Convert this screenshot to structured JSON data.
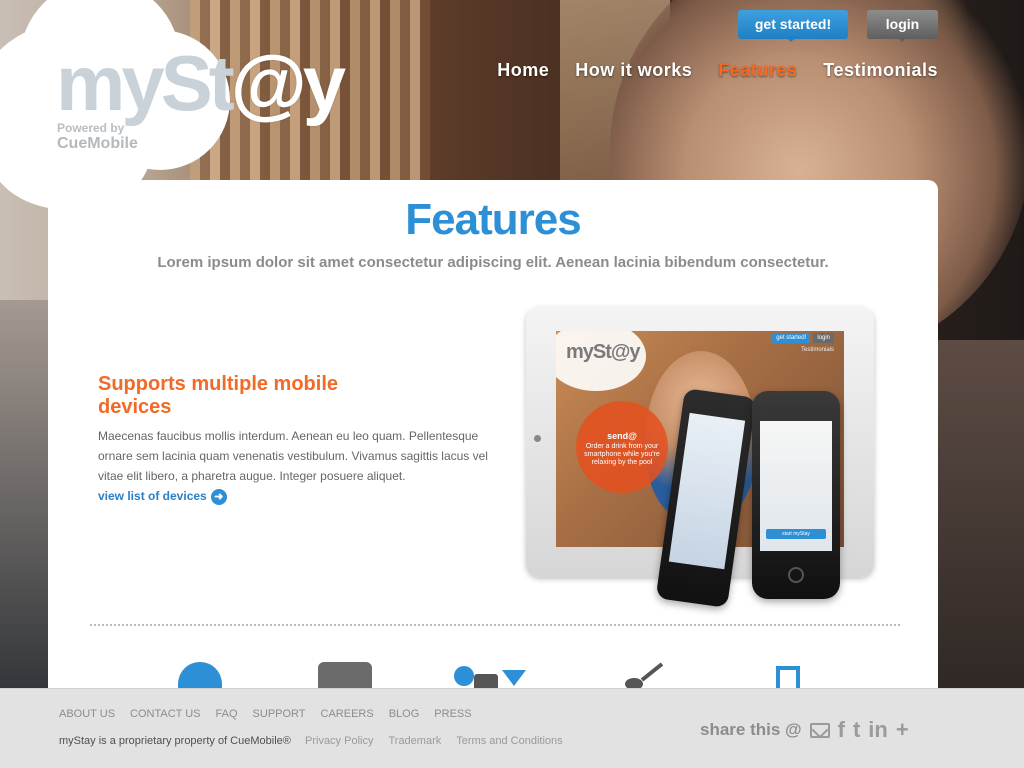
{
  "brand": {
    "logo_text": "myst@y",
    "logo_main": "my",
    "logo_st": "St",
    "logo_at": "@y",
    "powered_by": "Powered by",
    "company": "CueMobile"
  },
  "top_buttons": {
    "get_started": "get started!",
    "login": "login"
  },
  "nav": {
    "items": [
      "Home",
      "How it works",
      "Features",
      "Testimonials"
    ],
    "active": "Features"
  },
  "main": {
    "title": "Features",
    "subtitle": "Lorem ipsum dolor sit amet consectetur adipiscing elit. Aenean lacinia bibendum consectetur.",
    "feature": {
      "heading": "Supports multiple mobile devices",
      "body": "Maecenas faucibus mollis interdum. Aenean eu leo quam. Pellentesque ornare sem lacinia quam venenatis vestibulum. Vivamus sagittis lacus vel vitae elit libero, a pharetra augue. Integer posuere aliquet.",
      "link": "view list of devices"
    },
    "device_screen": {
      "logo": "mySt@y",
      "send_title": "send@",
      "send_text": "Order a drink from your smartphone while you're relaxing by the pool",
      "get_started": "get started!",
      "login": "login",
      "testimonials": "Testimonials",
      "start_button": "start myStay"
    }
  },
  "feature_icons": [
    "bell-icon",
    "box-icon",
    "drink-icon",
    "dine-icon",
    "door-icon"
  ],
  "colors": {
    "accent_blue": "#2d8fd5",
    "accent_orange": "#f26a25",
    "footer_bg": "#e2e2e2"
  },
  "footer": {
    "links": [
      "ABOUT US",
      "CONTACT US",
      "FAQ",
      "SUPPORT",
      "CAREERS",
      "BLOG",
      "PRESS"
    ],
    "copyright": "myStay is a proprietary property of CueMobile®",
    "legal": [
      "Privacy Policy",
      "Trademark",
      "Terms and Conditions"
    ],
    "share_label": "share this @",
    "share_icons": [
      "mail-icon",
      "facebook-icon",
      "twitter-icon",
      "linkedin-icon",
      "plus-icon"
    ]
  }
}
